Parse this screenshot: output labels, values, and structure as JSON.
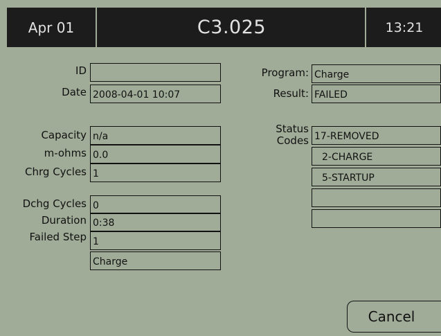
{
  "header": {
    "date": "Apr 01",
    "title": "C3.025",
    "time": "13:21"
  },
  "left_fields": [
    {
      "label": "ID",
      "value": ""
    },
    {
      "label": "Date",
      "value": "2008-04-01 10:07"
    },
    {
      "label": "Capacity",
      "value": "n/a"
    },
    {
      "label": "m-ohms",
      "value": "0.0"
    },
    {
      "label": "Chrg Cycles",
      "value": "1"
    },
    {
      "label": "Dchg Cycles",
      "value": "0"
    },
    {
      "label": "Duration",
      "value": "0:38"
    },
    {
      "label": "Failed Step",
      "value": "1"
    },
    {
      "label": "",
      "value": "Charge"
    }
  ],
  "right_fields": {
    "program_label": "Program:",
    "program_value": "Charge",
    "result_label": "Result:",
    "result_value": "FAILED",
    "status_label_line1": "Status",
    "status_label_line2": "Codes",
    "status_codes": [
      "17-REMOVED",
      " 2-CHARGE",
      " 5-STARTUP",
      "",
      ""
    ]
  },
  "buttons": {
    "cancel_label": "Cancel"
  }
}
